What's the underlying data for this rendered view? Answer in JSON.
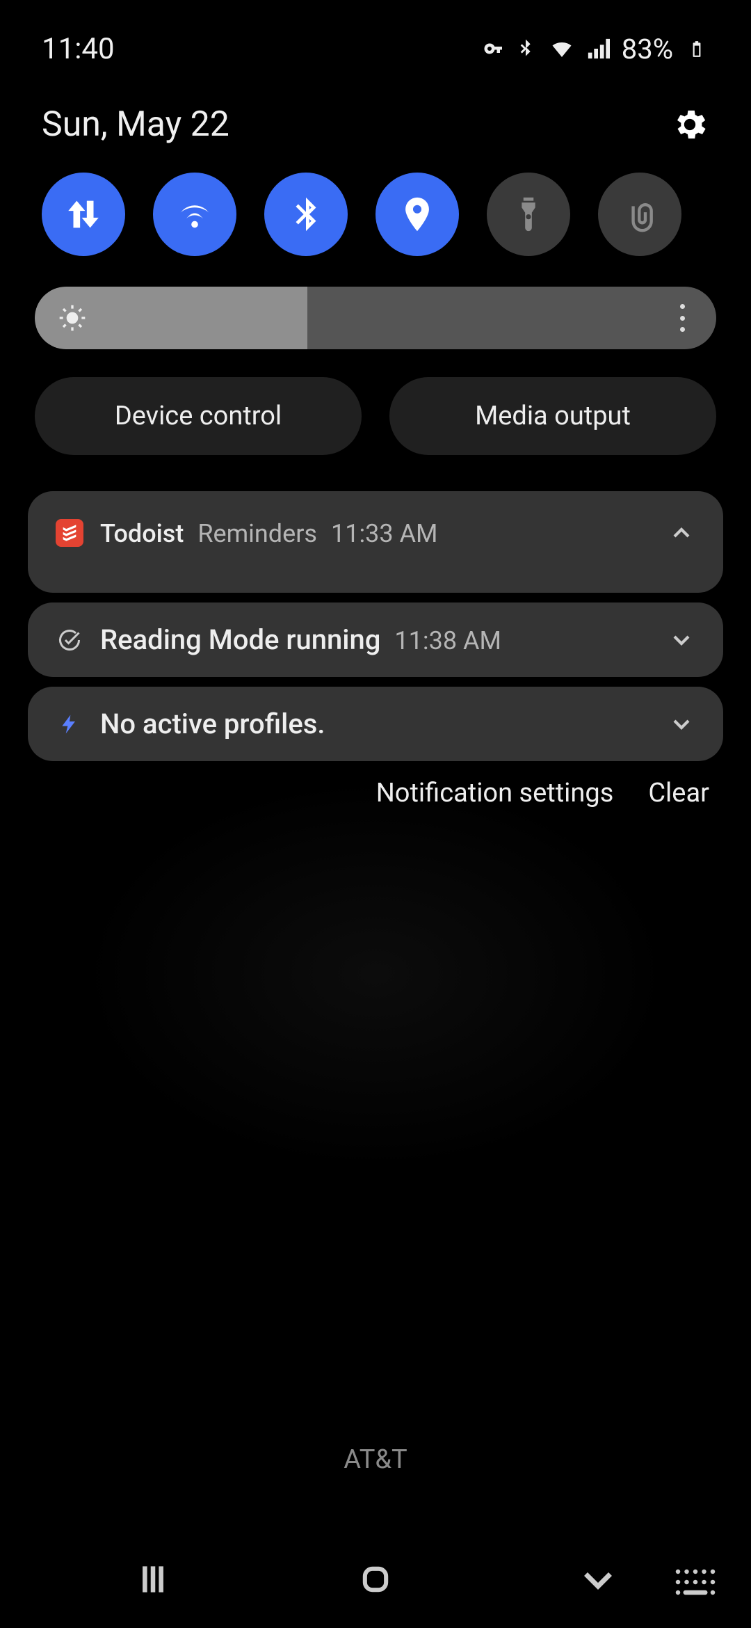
{
  "status": {
    "time": "11:40",
    "battery_pct": "83%",
    "icons": [
      "vpn-key",
      "bluetooth",
      "wifi",
      "cell-signal",
      "battery"
    ]
  },
  "header": {
    "date": "Sun, May 22"
  },
  "quick_settings": [
    {
      "name": "mobile-data",
      "on": true
    },
    {
      "name": "wifi",
      "on": true
    },
    {
      "name": "bluetooth",
      "on": true
    },
    {
      "name": "location",
      "on": true
    },
    {
      "name": "flashlight",
      "on": false
    },
    {
      "name": "link-to-windows",
      "on": false
    }
  ],
  "brightness": {
    "level_pct": 40
  },
  "shortcuts": {
    "device_control": "Device control",
    "media_output": "Media output"
  },
  "notifications": [
    {
      "app": "Todoist",
      "channel": "Reminders",
      "time": "11:33 AM",
      "icon": "todoist",
      "expanded": true
    },
    {
      "title": "Reading Mode running",
      "time": "11:38 AM",
      "icon": "check-circle",
      "expanded": false
    },
    {
      "title": "No active profiles.",
      "icon": "bolt",
      "expanded": false
    }
  ],
  "actions": {
    "settings": "Notification settings",
    "clear": "Clear"
  },
  "carrier": "AT&T",
  "colors": {
    "accent": "#3A6CF4",
    "panel": "#343434",
    "todoist": "#E44332"
  }
}
